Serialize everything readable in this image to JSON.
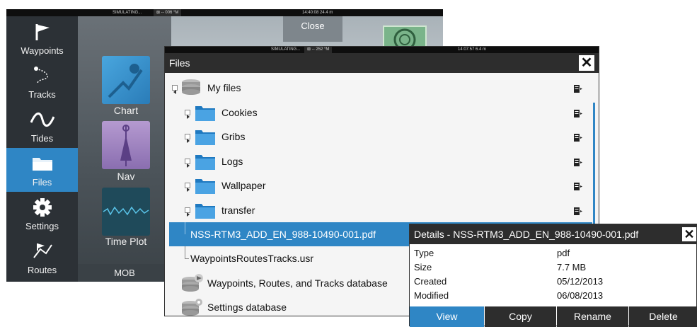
{
  "home": {
    "status": {
      "sim": "SIMULATING...",
      "heading": "⊠ -- 006 °M",
      "time": "14:40:08  24.4 m"
    },
    "sidebar": [
      {
        "label": "Waypoints",
        "icon": "flag-icon",
        "active": false
      },
      {
        "label": "Tracks",
        "icon": "tracks-icon",
        "active": false
      },
      {
        "label": "Tides",
        "icon": "tides-icon",
        "active": false
      },
      {
        "label": "Files",
        "icon": "folder-icon",
        "active": true
      },
      {
        "label": "Settings",
        "icon": "gear-icon",
        "active": false
      },
      {
        "label": "Routes",
        "icon": "routes-icon",
        "active": false
      }
    ],
    "tiles": {
      "chart": "Chart",
      "nav": "Nav",
      "timeplot": "Time Plot",
      "mob": "MOB",
      "close": "Close"
    }
  },
  "files": {
    "status": {
      "sim": "SIMULATING...",
      "heading": "⊠ -- 252 °M",
      "time": "14:07:57  6.4 m"
    },
    "title": "Files",
    "close": "✕",
    "rows": [
      {
        "label": "My files"
      },
      {
        "label": "Cookies"
      },
      {
        "label": "Gribs"
      },
      {
        "label": "Logs"
      },
      {
        "label": "Wallpaper"
      },
      {
        "label": "transfer"
      },
      {
        "label": "NSS-RTM3_ADD_EN_988-10490-001.pdf"
      },
      {
        "label": "WaypointsRoutesTracks.usr"
      },
      {
        "label": "Waypoints, Routes, and Tracks database"
      },
      {
        "label": "Settings database"
      }
    ]
  },
  "details": {
    "title": "Details - NSS-RTM3_ADD_EN_988-10490-001.pdf",
    "close": "✕",
    "fields": [
      {
        "label": "Type",
        "value": "pdf"
      },
      {
        "label": "Size",
        "value": "7.7 MB"
      },
      {
        "label": "Created",
        "value": "05/12/2013"
      },
      {
        "label": "Modified",
        "value": "06/08/2013"
      }
    ],
    "buttons": [
      "View",
      "Copy",
      "Rename",
      "Delete"
    ]
  },
  "colors": {
    "accent": "#2f86c5",
    "titlebar": "#2d2d2d"
  }
}
